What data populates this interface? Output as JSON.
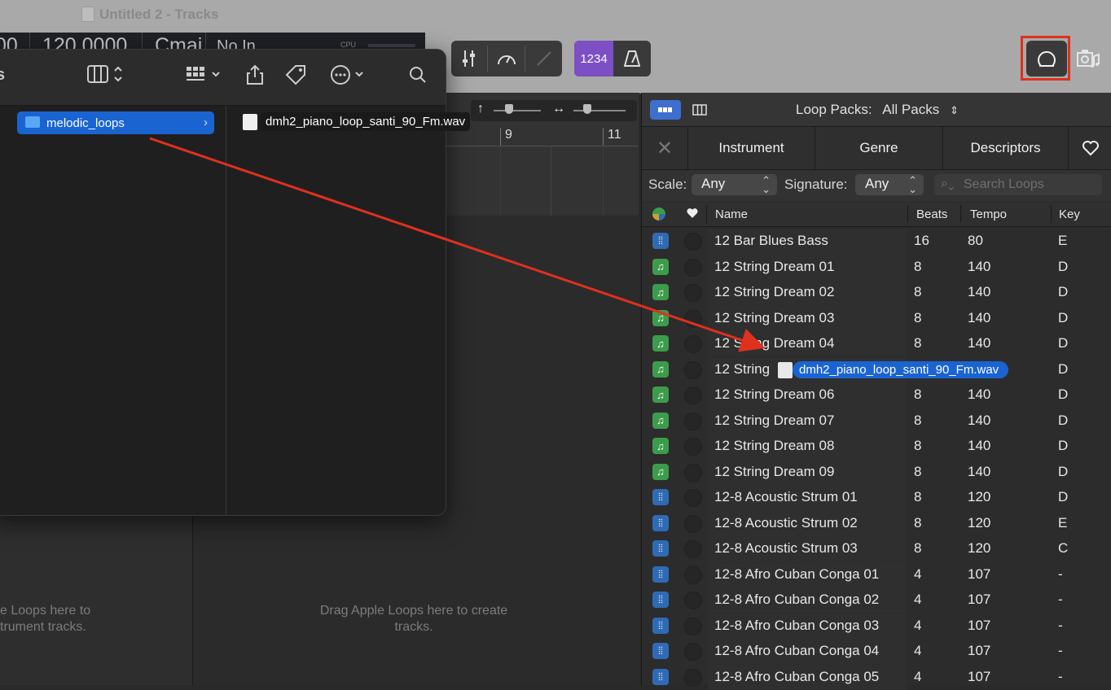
{
  "window": {
    "title": "Untitled 2 - Tracks"
  },
  "lcd": {
    "bars": "00",
    "tempo": "120.0000",
    "key": "Cmaj",
    "input": "No In",
    "cpu": "CPU"
  },
  "toolbar": {
    "count_in": "1234"
  },
  "finder": {
    "sidebar_partial_text": "s",
    "folder": "melodic_loops",
    "file": "dmh2_piano_loop_santi_90_Fm.wav"
  },
  "ruler": {
    "bar9": "9",
    "bar11": "11"
  },
  "tracks": {
    "drag_message": "Drag Apple Loops here to create tracks.",
    "drag_message_left": "e Loops here to\ntrument tracks."
  },
  "loop_browser": {
    "loop_packs_label": "Loop Packs:",
    "loop_packs_value": "All Packs",
    "filters": [
      "Instrument",
      "Genre",
      "Descriptors"
    ],
    "scale_label": "Scale:",
    "scale_value": "Any",
    "signature_label": "Signature:",
    "signature_value": "Any",
    "search_placeholder": "Search Loops",
    "columns": {
      "name": "Name",
      "beats": "Beats",
      "tempo": "Tempo",
      "key": "Key"
    },
    "drag_ghost": "dmh2_piano_loop_santi_90_Fm.wav",
    "rows": [
      {
        "type": "audio",
        "name": "12 Bar Blues Bass",
        "beats": "16",
        "tempo": "80",
        "key": "E"
      },
      {
        "type": "midi",
        "name": "12 String Dream 01",
        "beats": "8",
        "tempo": "140",
        "key": "D"
      },
      {
        "type": "midi",
        "name": "12 String Dream 02",
        "beats": "8",
        "tempo": "140",
        "key": "D"
      },
      {
        "type": "midi",
        "name": "12 String Dream 03",
        "beats": "8",
        "tempo": "140",
        "key": "D"
      },
      {
        "type": "midi",
        "name": "12 String Dream 04",
        "beats": "8",
        "tempo": "140",
        "key": "D"
      },
      {
        "type": "midi",
        "name": "12 String",
        "beats": "",
        "tempo": "",
        "key": "D"
      },
      {
        "type": "midi",
        "name": "12 String Dream 06",
        "beats": "8",
        "tempo": "140",
        "key": "D"
      },
      {
        "type": "midi",
        "name": "12 String Dream 07",
        "beats": "8",
        "tempo": "140",
        "key": "D"
      },
      {
        "type": "midi",
        "name": "12 String Dream 08",
        "beats": "8",
        "tempo": "140",
        "key": "D"
      },
      {
        "type": "midi",
        "name": "12 String Dream 09",
        "beats": "8",
        "tempo": "140",
        "key": "D"
      },
      {
        "type": "audio",
        "name": "12-8 Acoustic Strum 01",
        "beats": "8",
        "tempo": "120",
        "key": "D"
      },
      {
        "type": "audio",
        "name": "12-8 Acoustic Strum 02",
        "beats": "8",
        "tempo": "120",
        "key": "E"
      },
      {
        "type": "audio",
        "name": "12-8 Acoustic Strum 03",
        "beats": "8",
        "tempo": "120",
        "key": "C"
      },
      {
        "type": "audio",
        "name": "12-8 Afro Cuban Conga 01",
        "beats": "4",
        "tempo": "107",
        "key": "-"
      },
      {
        "type": "audio",
        "name": "12-8 Afro Cuban Conga 02",
        "beats": "4",
        "tempo": "107",
        "key": "-"
      },
      {
        "type": "audio",
        "name": "12-8 Afro Cuban Conga 03",
        "beats": "4",
        "tempo": "107",
        "key": "-"
      },
      {
        "type": "audio",
        "name": "12-8 Afro Cuban Conga 04",
        "beats": "4",
        "tempo": "107",
        "key": "-"
      },
      {
        "type": "audio",
        "name": "12-8 Afro Cuban Conga 05",
        "beats": "4",
        "tempo": "107",
        "key": "-"
      }
    ]
  },
  "colors": {
    "accent_purple": "#7d4fc4",
    "selection_blue": "#1a64d2",
    "highlight_red": "#e0301e",
    "midi_green": "#3c9c4b",
    "audio_blue": "#2f6bb5"
  },
  "icons": {
    "loop_browser": "loop-icon",
    "browsers": "media-browser-icon"
  }
}
